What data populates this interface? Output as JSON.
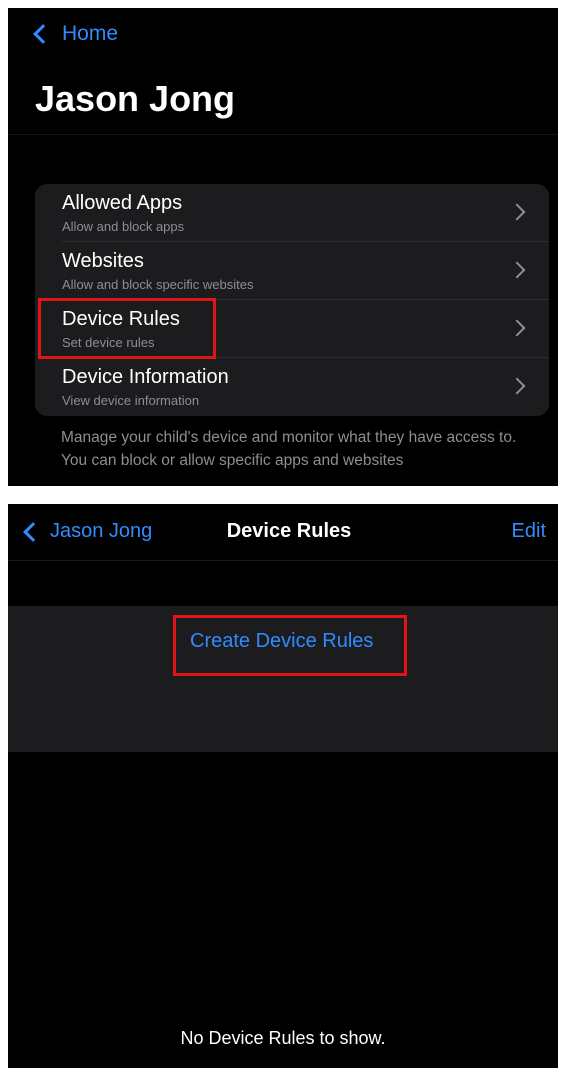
{
  "top": {
    "back_label": "Home",
    "title": "Jason Jong",
    "items": [
      {
        "title": "Allowed Apps",
        "subtitle": "Allow and block apps"
      },
      {
        "title": "Websites",
        "subtitle": "Allow and block specific websites"
      },
      {
        "title": "Device Rules",
        "subtitle": "Set device rules"
      },
      {
        "title": "Device Information",
        "subtitle": "View device information"
      }
    ],
    "footer": "Manage your child's device and monitor what they have access to. You can block or allow specific apps and websites"
  },
  "bottom": {
    "back_label": "Jason Jong",
    "title": "Device Rules",
    "edit_label": "Edit",
    "create_label": "Create Device Rules",
    "empty_message": "No Device Rules to show."
  },
  "colors": {
    "accent": "#2f8cff",
    "highlight": "#e0151b",
    "background": "#000000",
    "card": "#1c1c1e"
  }
}
